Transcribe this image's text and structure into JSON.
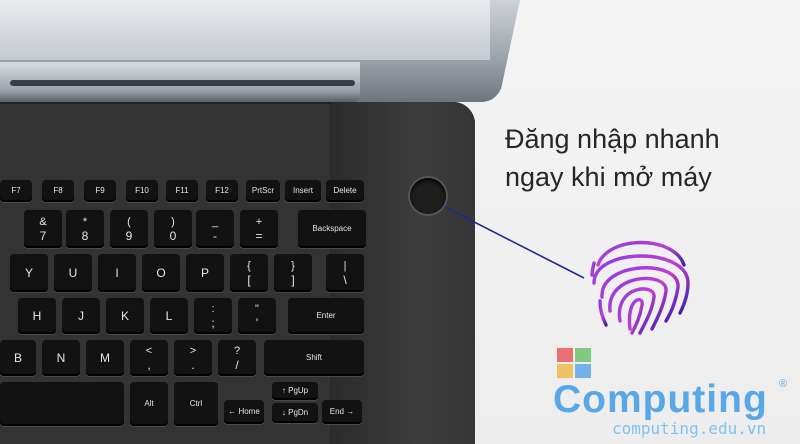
{
  "headline": [
    "Đăng nhập nhanh",
    "ngay khi mở máy"
  ],
  "logo": {
    "word": "Computing",
    "reg": "®",
    "url": "computing.edu.vn",
    "colors": [
      "#5aa7e8",
      "#e85a5a",
      "#6cc36c",
      "#f0b84a"
    ]
  },
  "keys": {
    "f7": "F7",
    "f8": "F8",
    "f9": "F9",
    "f10": "F10",
    "f11": "F11",
    "f12": "F12",
    "prtscr": "PrtScr",
    "insert": "Insert",
    "delete": "Delete",
    "amp_top": "&",
    "amp_bot": "7",
    "star_top": "*",
    "star_bot": "8",
    "lparen_top": "(",
    "lparen_bot": "9",
    "rparen_top": ")",
    "rparen_bot": "0",
    "under_top": "_",
    "under_bot": "-",
    "plus_top": "+",
    "plus_bot": "=",
    "backspace": "Backspace",
    "y": "Y",
    "u": "U",
    "i": "I",
    "o": "O",
    "p": "P",
    "lbrace_top": "{",
    "lbrace_bot": "[",
    "rbrace_top": "}",
    "rbrace_bot": "]",
    "pipe_top": "|",
    "pipe_bot": "\\",
    "h": "H",
    "j": "J",
    "k": "K",
    "l": "L",
    "colon_top": ":",
    "colon_bot": ";",
    "quote_top": "\"",
    "quote_bot": "'",
    "enter": "Enter",
    "b": "B",
    "n": "N",
    "m": "M",
    "lt_top": "<",
    "lt_bot": ",",
    "gt_top": ">",
    "gt_bot": ".",
    "q_top": "?",
    "q_bot": "/",
    "shift": "Shift",
    "alt": "Alt",
    "ctrl": "Ctrl",
    "home": "Home",
    "pgup": "PgUp",
    "pgdn": "PgDn",
    "end": "End"
  }
}
